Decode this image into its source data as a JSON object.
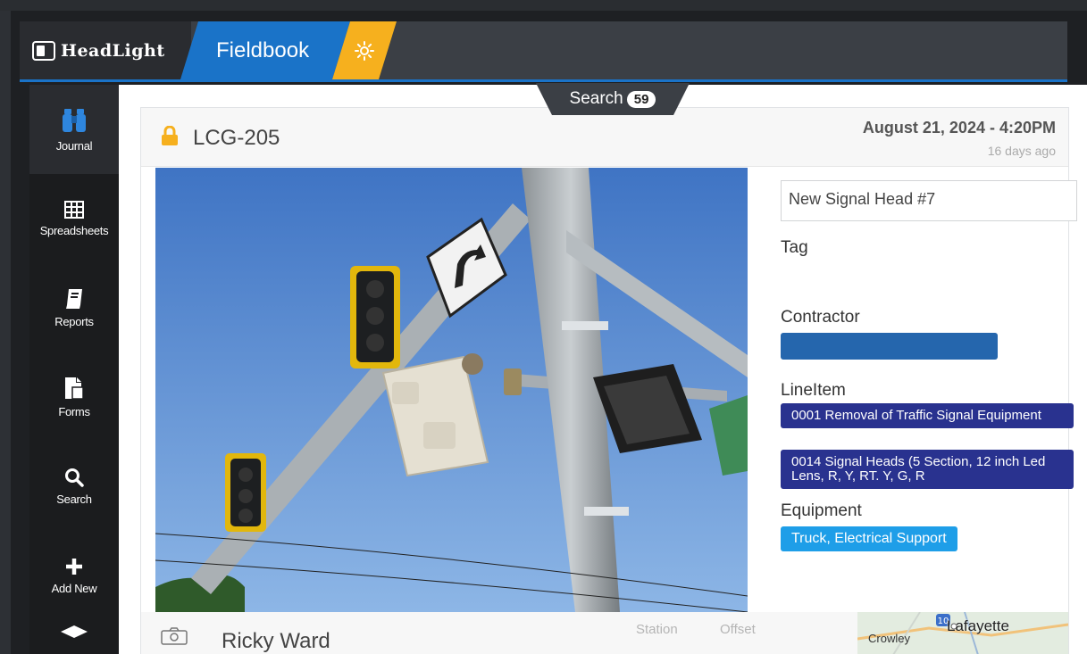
{
  "header": {
    "logo_text": "HeadLight",
    "app_title": "Fieldbook"
  },
  "sidebar": {
    "items": [
      {
        "label": "Journal",
        "icon": "binoculars-icon"
      },
      {
        "label": "Spreadsheets",
        "icon": "grid-icon"
      },
      {
        "label": "Reports",
        "icon": "book-icon"
      },
      {
        "label": "Forms",
        "icon": "forms-icon"
      },
      {
        "label": "Search",
        "icon": "search-icon"
      },
      {
        "label": "Add New",
        "icon": "plus-icon"
      }
    ]
  },
  "search_tab": {
    "label": "Search",
    "count": "59"
  },
  "record": {
    "id": "LCG-205",
    "date": "August 21, 2024 - 4:20PM",
    "ago": "16 days ago",
    "title_value": "New Signal Head #7",
    "tag_label": "Tag",
    "contractor_label": "Contractor",
    "lineitem_label": "LineItem",
    "line_items": [
      "0001 Removal of Traffic Signal Equipment",
      "0014 Signal Heads (5 Section, 12 inch Led Lens, R, Y, RT. Y, G, R"
    ],
    "equipment_label": "Equipment",
    "equipment": [
      "Truck, Electrical Support"
    ],
    "author": "Ricky Ward",
    "station_label": "Station",
    "offset_label": "Offset"
  },
  "map": {
    "city_1": "Lafayette",
    "city_2": "Crowley"
  },
  "colors": {
    "brand_blue": "#1a73c8",
    "accent_yellow": "#f6b01e",
    "lineitem_navy": "#29328f",
    "equipment_cyan": "#1e9ee8",
    "contractor_blue": "#2566ad"
  }
}
